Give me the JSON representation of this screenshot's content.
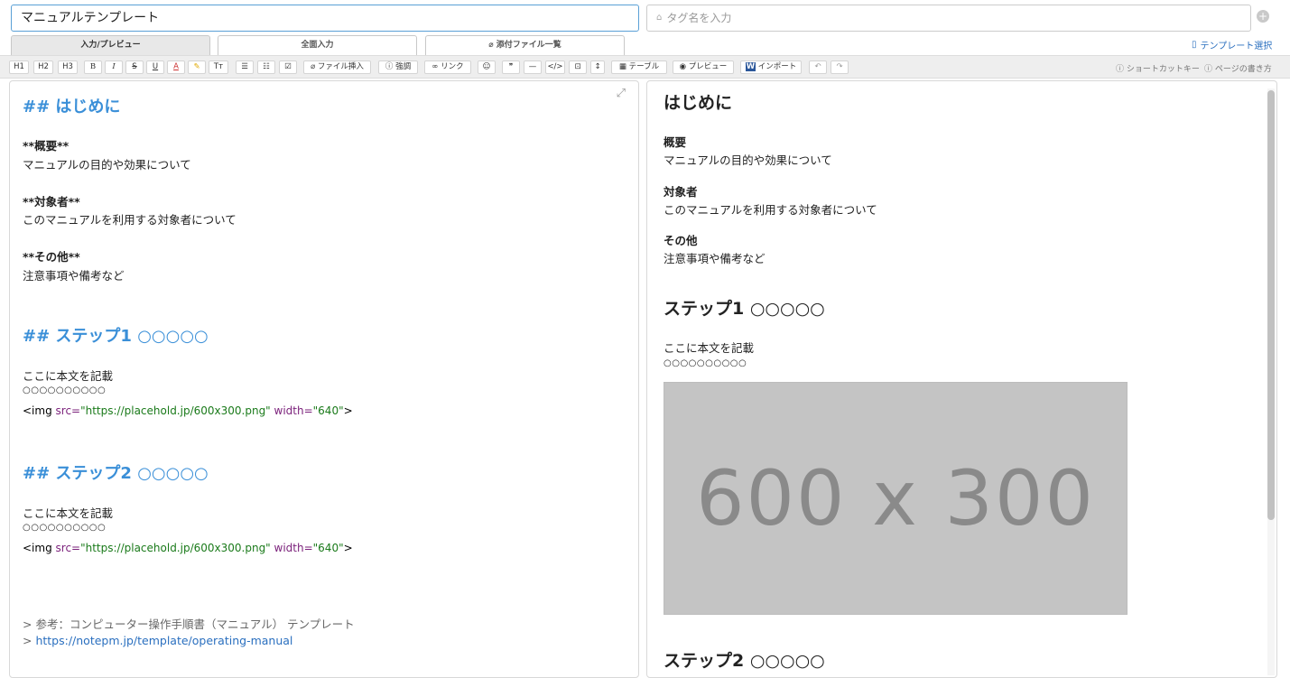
{
  "header": {
    "title_value": "マニュアルテンプレート",
    "tag_placeholder": "タグ名を入力",
    "template_select": "テンプレート選択"
  },
  "tabs": [
    "入力/プレビュー",
    "全面入力",
    "添付ファイル一覧"
  ],
  "toolbar": {
    "buttons": [
      "H1",
      "H2",
      "H3",
      "B",
      "I",
      "S",
      "U",
      "A",
      "",
      "Tт",
      "",
      "",
      "",
      "ファイル挿入",
      "強調",
      "リンク",
      "",
      "❞",
      "—",
      "</>",
      "⊡",
      "↕",
      "テーブル",
      "プレビュー",
      "インポート",
      "↶",
      "↷"
    ],
    "shortcut": "ショートカットキー",
    "howto": "ページの書き方"
  },
  "editor": {
    "h_intro": "## はじめに",
    "overview_label": "**概要**",
    "overview_text": "マニュアルの目的や効果について",
    "target_label": "**対象者**",
    "target_text": "このマニュアルを利用する対象者について",
    "other_label": "**その他**",
    "other_text": "注意事項や備考など",
    "h_step1": "## ステップ1 ○○○○○",
    "body1": "ここに本文を記載",
    "circles1": "○○○○○○○○○○",
    "img_open": "<img ",
    "img_src_attr": "src=",
    "img_src_val": "\"https://placehold.jp/600x300.png\"",
    "img_width_attr": " width=",
    "img_width_val": "\"640\"",
    "img_close": ">",
    "h_step2": "## ステップ2 ○○○○○",
    "body2": "ここに本文を記載",
    "circles2": "○○○○○○○○○○",
    "quote1": "> 参考：コンピューター操作手順書（マニュアル） テンプレート",
    "quote2_prefix": "> ",
    "quote2_link": "https://notepm.jp/template/operating-manual"
  },
  "preview": {
    "h_intro": "はじめに",
    "overview_label": "概要",
    "overview_text": "マニュアルの目的や効果について",
    "target_label": "対象者",
    "target_text": "このマニュアルを利用する対象者について",
    "other_label": "その他",
    "other_text": "注意事項や備考など",
    "h_step1": "ステップ1 ○○○○○",
    "body1": "ここに本文を記載",
    "circles1": "○○○○○○○○○○",
    "image_text": "600 x 300",
    "h_step2": "ステップ2 ○○○○○"
  }
}
